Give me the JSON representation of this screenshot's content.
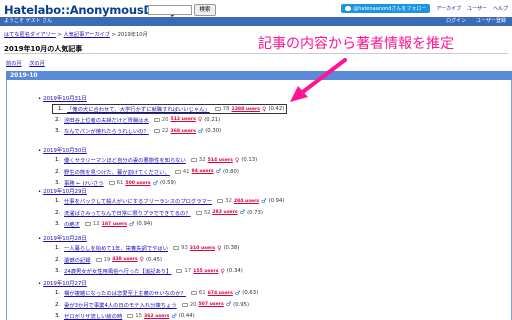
{
  "header": {
    "logo": "Hatelabo::AnonymousDiary",
    "search_button": "検索",
    "twitter_follow": "@hatenaanondさんをフォロー",
    "nav": [
      "アーカイブ",
      "ユーザー",
      "ヘルプ"
    ]
  },
  "userbar": {
    "greeting": "ようこそ ゲスト さん",
    "links": [
      "ログイン",
      "ユーザー登録"
    ]
  },
  "breadcrumb": {
    "home": "はてな匿名ダイアリー",
    "archive": "人気記事アーカイブ",
    "current": "2019年10月"
  },
  "page_title": "2019年10月の人気記事",
  "pager": {
    "prev": "前の月",
    "next": "次の月"
  },
  "section": "2019-10",
  "annotation": "記事の内容から著者情報を推定",
  "days": [
    {
      "label": "2019年10月31日",
      "entries": [
        {
          "num": "1.",
          "title": "「俺の犬に合わせて、大学行かずに就職すればいいじゃん」",
          "comments": "78",
          "users": "1388 users",
          "gender": "female",
          "score": "(0.42)"
        },
        {
          "num": "2.",
          "title": "淫田谷上位者の夫婦だけど胃腸は水",
          "comments": "20",
          "users": "512 users",
          "gender": "female",
          "score": "(0.21)"
        },
        {
          "num": "3.",
          "title": "なんでパンが焼れたらうれしいの？",
          "comments": "22",
          "users": "368 users",
          "gender": "male",
          "score": "(0.30)"
        }
      ]
    },
    {
      "label": "2019年10月30日",
      "entries": [
        {
          "num": "1.",
          "title": "優くサラリーマンほど自分の妻の悪態性を知らない",
          "comments": "32",
          "users": "514 users",
          "gender": "female",
          "score": "(0.13)"
        },
        {
          "num": "2.",
          "title": "野生の熊を見つけた、暮か割けてください。",
          "comments": "41",
          "users": "94 users",
          "gender": "male",
          "score": "(0.80)"
        },
        {
          "num": "3.",
          "title": "事務 ← けいさう",
          "comments": "61",
          "users": "500 users",
          "gender": "male",
          "score": "(0.59)"
        }
      ]
    },
    {
      "label": "2019年10月29日",
      "entries": [
        {
          "num": "1.",
          "title": "仕事をバックして殺人がいにするフリーランスのプログラマー",
          "comments": "32",
          "users": "284 users",
          "gender": "male",
          "score": "(0.94)"
        },
        {
          "num": "2.",
          "title": "洗濯ばさみってなんで日常に限りプラでできてるの？",
          "comments": "32",
          "users": "282 users",
          "gender": "male",
          "score": "(0.73)"
        },
        {
          "num": "3.",
          "title": "の絶才",
          "comments": "12",
          "users": "187 users",
          "gender": "male",
          "score": "(0.94)"
        }
      ]
    },
    {
      "label": "2019年10月28日",
      "entries": [
        {
          "num": "1.",
          "title": "一人暮らしを始めて1年、栄養失調でやばい",
          "comments": "93",
          "users": "310 users",
          "gender": "female",
          "score": "(0.38)"
        },
        {
          "num": "2.",
          "title": "遺憾の記録",
          "comments": "19",
          "users": "438 users",
          "gender": "female",
          "score": "(0.45)"
        },
        {
          "num": "3.",
          "title": "24歳男女が女性用風俗へ行った【追記あり】",
          "comments": "17",
          "users": "155 users",
          "gender": "female",
          "score": "(0.34)"
        }
      ]
    },
    {
      "label": "2019年10月27日",
      "entries": [
        {
          "num": "1.",
          "title": "構が複雑になったのは恋愛至上主義のせいなのか？",
          "comments": "61",
          "users": "674 users",
          "gender": "male",
          "score": "(0.63)"
        },
        {
          "num": "2.",
          "title": "妻が3か月で事業4人の日のモテ入れ分策ちょう",
          "comments": "20",
          "users": "507 users",
          "gender": "male",
          "score": "(0.95)"
        },
        {
          "num": "3.",
          "title": "ゼロがリザ流しい絵の時",
          "comments": "15",
          "users": "362 users",
          "gender": "male",
          "score": "(0.44)"
        }
      ]
    }
  ]
}
